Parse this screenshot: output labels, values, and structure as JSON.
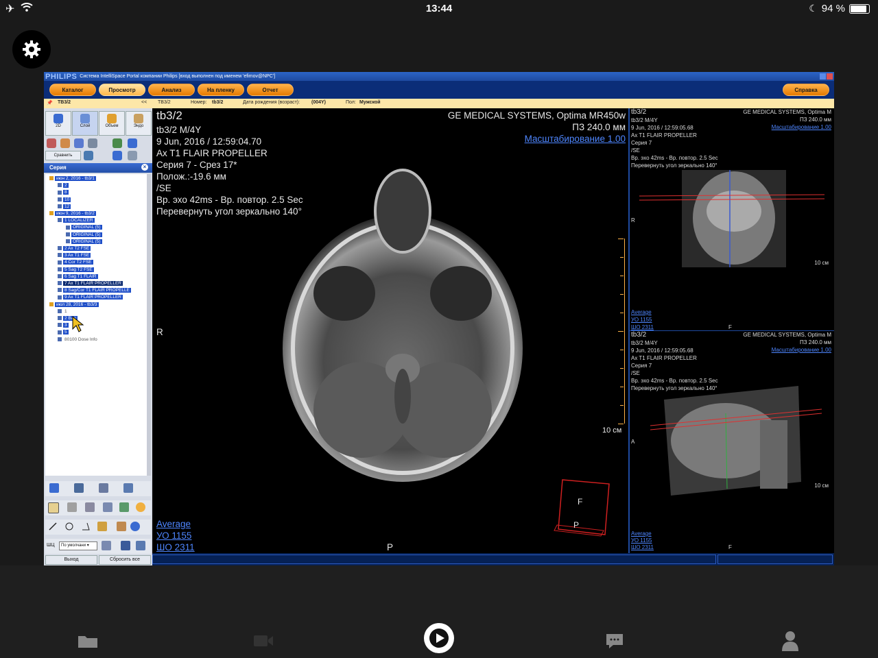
{
  "status_bar": {
    "time": "13:44",
    "battery_text": "94 %",
    "battery_level": 0.94
  },
  "app": {
    "brand": "PHILIPS",
    "title": "Система IntelliSpace Portal компании Philips [вход выполнен под именем 'efimov@NPC']",
    "menu": [
      "Каталог",
      "Просмотр",
      "Анализ",
      "На пленку",
      "Отчет"
    ],
    "selected_menu": "Просмотр",
    "help_button": "Справка",
    "infobar": {
      "tab": "TB3/2",
      "collapse": "<<",
      "patient": "TB3/2",
      "number_label": "Номер:",
      "number": "tb3/2",
      "dob_label": "Дата рождения (возраст):",
      "dob": "(004Y)",
      "sex_label": "Пол:",
      "sex": "Мужской"
    },
    "left_panel": {
      "view_buttons": [
        "2D",
        "Слой",
        "Объем",
        "Эндо"
      ],
      "compare_button": "Сравнить",
      "series_header": "Серия",
      "tree": [
        {
          "level": 0,
          "text": "июн 2, 2016 - tb3/1"
        },
        {
          "level": 1,
          "text": "2"
        },
        {
          "level": 1,
          "text": "8"
        },
        {
          "level": 1,
          "text": "10"
        },
        {
          "level": 1,
          "text": "12"
        },
        {
          "level": 0,
          "text": "июн 9, 2016 - tb3/2"
        },
        {
          "level": 1,
          "text": "1 LOCALIZER"
        },
        {
          "level": 2,
          "text": "ORIGINAL (5)"
        },
        {
          "level": 2,
          "text": "ORIGINAL (5)"
        },
        {
          "level": 2,
          "text": "ORIGINAL (5)"
        },
        {
          "level": 1,
          "text": "2 Ax T2 FSE"
        },
        {
          "level": 1,
          "text": "3 Ax T1 FSE"
        },
        {
          "level": 1,
          "text": "4 Cor T2 FSE"
        },
        {
          "level": 1,
          "text": "5 Sag T2 FSE"
        },
        {
          "level": 1,
          "text": "6 Sag T1 FLAIR"
        },
        {
          "level": 1,
          "text": "7 Ax T1 FLAIR PROPELLER",
          "dark": true
        },
        {
          "level": 1,
          "text": "8 Sag/Cor T1 FLAIR PROPELLE"
        },
        {
          "level": 1,
          "text": "9 Ax T1 FLAIR PROPELLER"
        },
        {
          "level": 0,
          "text": "июл 28, 2016 - tb3/3"
        },
        {
          "level": 1,
          "text": "1",
          "plain": true
        },
        {
          "level": 1,
          "text": "2 Ban"
        },
        {
          "level": 1,
          "text": "3"
        },
        {
          "level": 1,
          "text": "5"
        },
        {
          "level": 1,
          "text": "80100 Dose Info",
          "plain": true
        }
      ],
      "layout_label": "ШЦ",
      "preset_select": "По умолчани",
      "exit_button": "Выход",
      "reset_button": "Сбросить все"
    },
    "main_view": {
      "top_left": [
        "tb3/2",
        "tb3/2 M/4Y",
        "9 Jun, 2016 / 12:59:04.70",
        "Ax T1 FLAIR PROPELLER",
        "Серия 7 - Срез 17*",
        "Полож.:-19.6 мм",
        "/SE",
        "Вр. эхо  42ms - Вр. повтор. 2.5 Sec",
        "Перевернуть угол зеркально 140°"
      ],
      "top_right": [
        "GE MEDICAL SYSTEMS, Optima MR450w",
        "ПЗ 240.0 мм"
      ],
      "zoom_link": "Масштабирование 1.00",
      "left_marker": "R",
      "bottom_marker": "P",
      "scale_label": "10 см",
      "orientation_cube": {
        "front": "F",
        "bottom": "P"
      },
      "bottom_left_link": "Average",
      "wl": [
        "УО   1155",
        "ШО  2311"
      ]
    },
    "right_top": {
      "lines": [
        "tb3/2",
        "tb3/2 M/4Y",
        "9 Jun, 2016 / 12:59:05.68",
        "Ax T1 FLAIR PROPELLER",
        "Серия 7",
        "/SE",
        "Вр. эхо  42ms - Вр. повтор. 2.5 Sec",
        "Перевернуть угол зеркально 140°"
      ],
      "vendor": [
        "GE MEDICAL SYSTEMS, Optima M",
        "ПЗ 240.0 мм"
      ],
      "zoom_link": "Масштабирование 1.00",
      "left_marker": "R",
      "scale_label": "10 см",
      "bottom_link": "Average",
      "wl": [
        "УО   1155",
        "ШО  2311"
      ],
      "bottom_marker": "F"
    },
    "right_bottom": {
      "lines": [
        "tb3/2",
        "tb3/2 M/4Y",
        "9 Jun, 2016 / 12:59:05.68",
        "Ax T1 FLAIR PROPELLER",
        "Серия 7",
        "/SE",
        "Вр. эхо  42ms - Вр. повтор. 2.5 Sec",
        "Перевернуть угол зеркально 140°"
      ],
      "vendor": [
        "GE MEDICAL SYSTEMS, Optima M",
        "ПЗ 240.0 мм"
      ],
      "zoom_link": "Масштабирование 1.00",
      "left_marker": "A",
      "scale_label": "10 см",
      "bottom_link": "Average",
      "wl": [
        "УО   1155",
        "ШО  2311"
      ],
      "bottom_marker": "F"
    }
  },
  "ios_toolbar": {
    "items": [
      "folder-icon",
      "video-icon",
      "play-icon",
      "chat-icon",
      "person-icon"
    ]
  },
  "colors": {
    "accent_orange": "#f59a1e",
    "title_blue": "#1e4aa0",
    "link_blue": "#4e86ff",
    "selection_blue": "#1e4ec8"
  }
}
